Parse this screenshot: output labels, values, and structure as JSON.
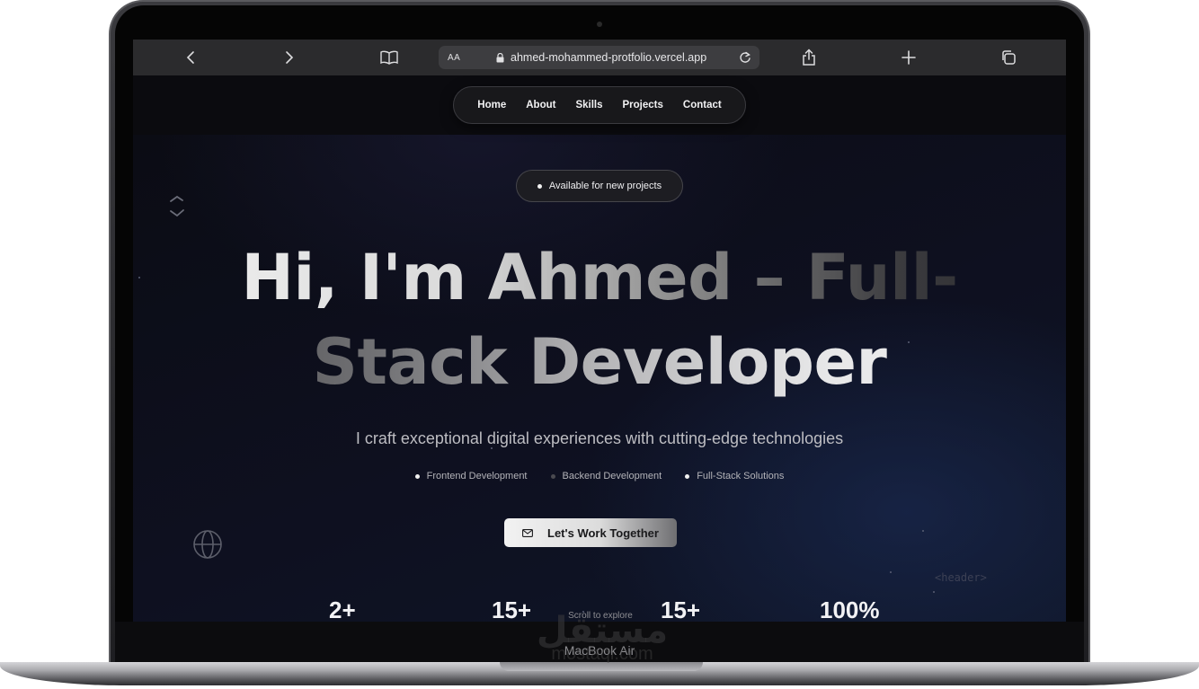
{
  "browser": {
    "aa_label": "AA",
    "url": "ahmed-mohammed-protfolio.vercel.app"
  },
  "nav": {
    "items": [
      "Home",
      "About",
      "Skills",
      "Projects",
      "Contact"
    ]
  },
  "hero": {
    "badge": "Available for new projects",
    "headline_line1": "Hi, I'm Ahmed – Full-",
    "headline_line2": "Stack Developer",
    "subtitle": "I craft exceptional digital experiences with cutting-edge technologies",
    "services": [
      {
        "label": "Frontend Development",
        "dot_color": "#f0f0f0"
      },
      {
        "label": "Backend Development",
        "dot_color": "#4a4a50"
      },
      {
        "label": "Full-Stack Solutions",
        "dot_color": "#f0f0f0"
      }
    ],
    "cta": "Let's Work Together",
    "decor_code": "<header>"
  },
  "stats": [
    "2+",
    "15+",
    "15+",
    "100%"
  ],
  "scroll_hint": "Scroll to explore",
  "device": {
    "model": "MacBook Air"
  },
  "watermark": {
    "arabic": "مستقل",
    "latin": "mostaql.com"
  }
}
